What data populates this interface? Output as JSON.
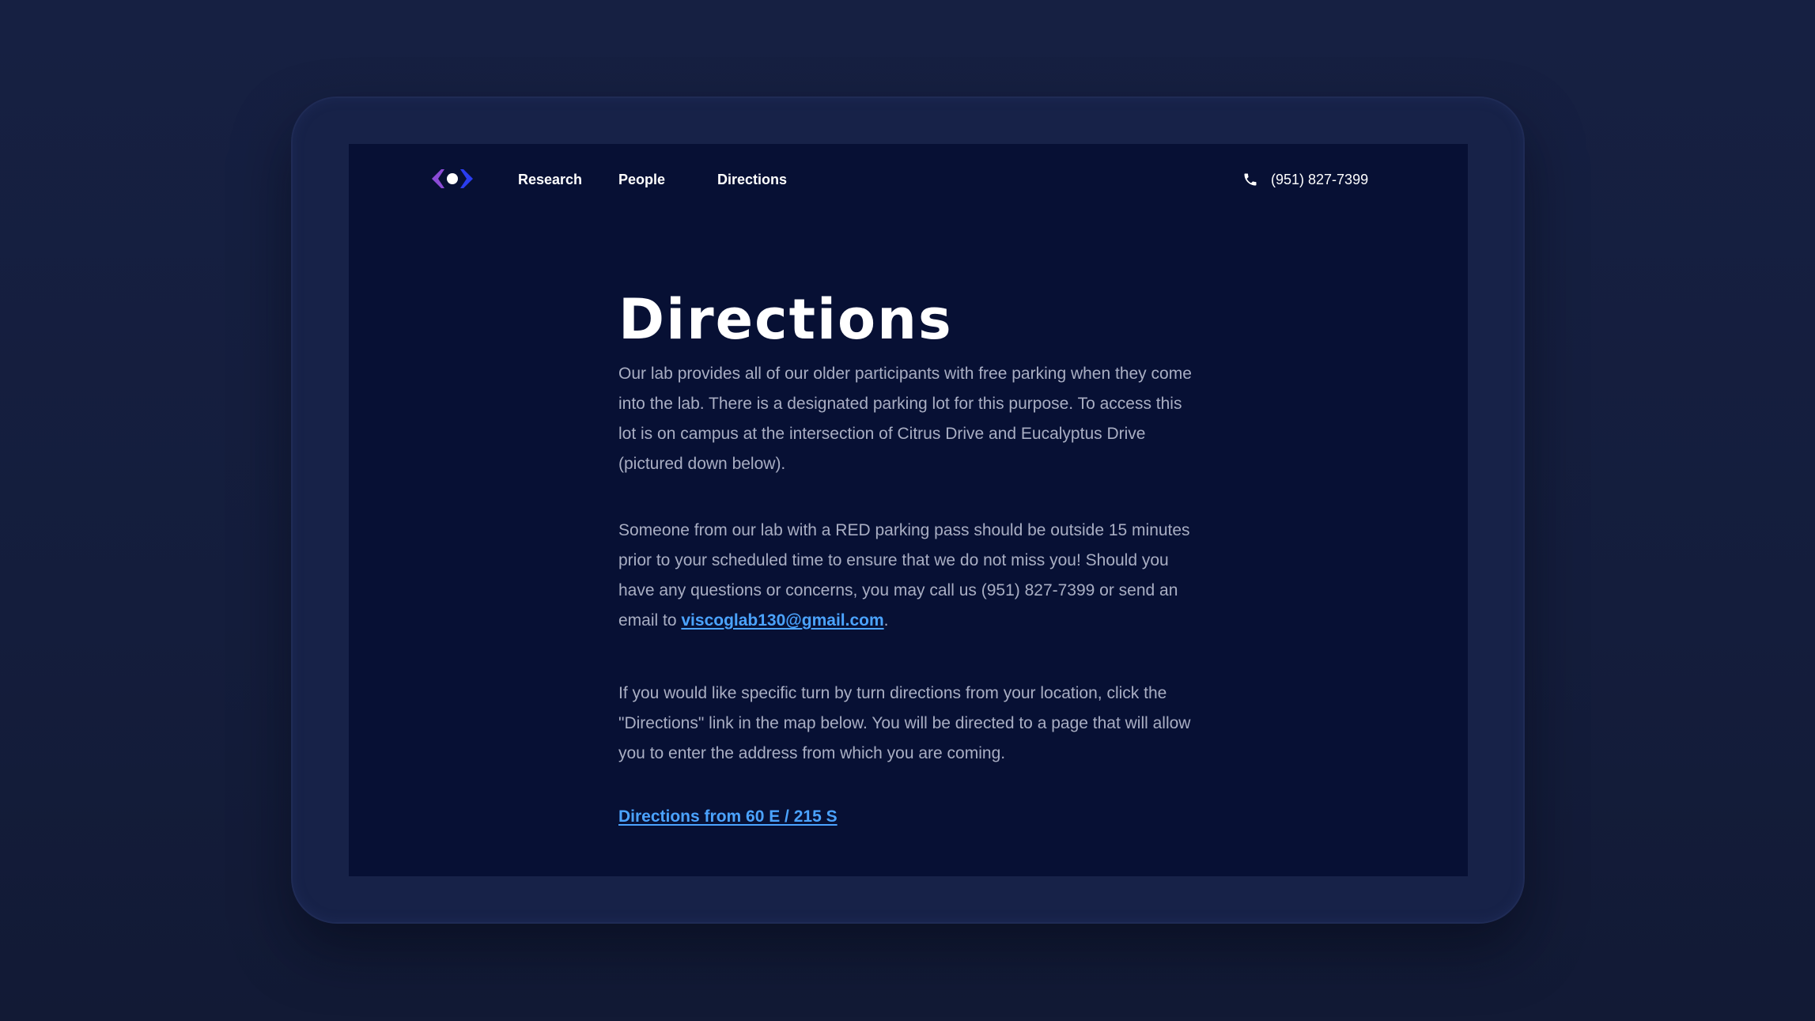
{
  "nav": {
    "logo_icon": "eye-logo-icon",
    "items": [
      {
        "label": "Research"
      },
      {
        "label": "People"
      },
      {
        "label": "Directions"
      }
    ],
    "phone_icon": "phone-icon",
    "phone": "(951) 827-7399"
  },
  "main": {
    "title": "Directions",
    "para1": "Our lab provides all of our older participants with free parking when they come into the lab. There is a designated parking lot for this purpose. To access this lot is on campus at the intersection of Citrus Drive and Eucalyptus Drive (pictured down below).",
    "para2_text": "Someone from our lab with a RED parking pass should be outside 15 minutes prior to your scheduled time to ensure that we do not miss you! Should you have any questions or concerns, you may call us (951) 827-7399 or send an email to ",
    "para2_email": "viscoglab130@gmail.com",
    "para2_end": ".",
    "para3": "If you would like specific turn by turn directions from your location, click the \"Directions\" link in the map below. You will be directed to a page that will allow you to enter the address from which you are coming.",
    "directions_link": "Directions from 60 E / 215 S"
  },
  "colors": {
    "page_background": "#162042",
    "device_frame": "#172248",
    "screen_background": "#071034",
    "body_text": "#a9aec3",
    "link": "#4ba3ff",
    "logo_purple": "#8b4bd6",
    "logo_blue": "#2a3df0"
  }
}
